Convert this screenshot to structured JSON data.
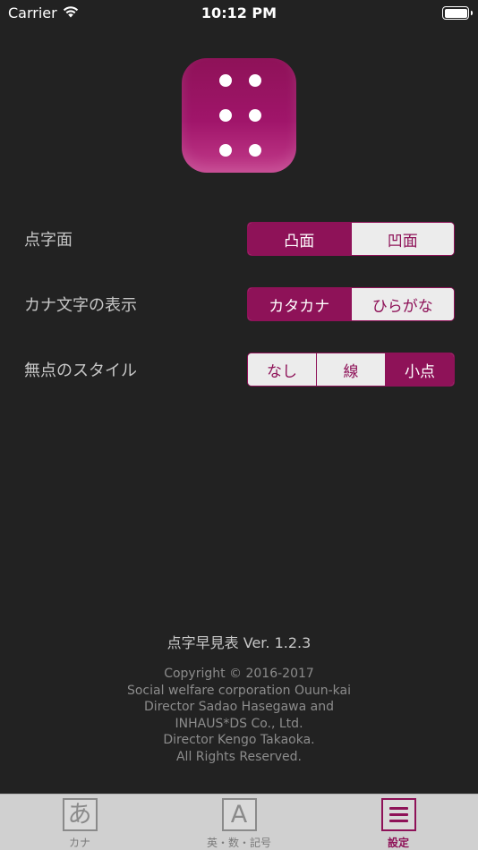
{
  "status_bar": {
    "carrier": "Carrier",
    "time": "10:12 PM",
    "wifi_icon": "wifi-icon",
    "battery_icon": "battery-icon"
  },
  "app_icon": {
    "name": "braille-six-dots-icon",
    "color": "#8e1258"
  },
  "settings": [
    {
      "label": "点字面",
      "options": [
        "凸面",
        "凹面"
      ],
      "selected": 0
    },
    {
      "label": "カナ文字の表示",
      "options": [
        "カタカナ",
        "ひらがな"
      ],
      "selected": 0
    },
    {
      "label": "無点のスタイル",
      "options": [
        "なし",
        "線",
        "小点"
      ],
      "selected": 2
    }
  ],
  "footer": {
    "version": "点字早見表 Ver. 1.2.3",
    "copyright_lines": [
      "Copyright © 2016-2017",
      "Social welfare corporation Ouun-kai",
      "Director Sadao Hasegawa and",
      "INHAUS*DS Co., Ltd.",
      "Director Kengo Takaoka.",
      "All Rights Reserved."
    ]
  },
  "tab_bar": {
    "tabs": [
      {
        "icon_glyph": "あ",
        "icon": "hiragana-a-icon",
        "label": "カナ",
        "active": false
      },
      {
        "icon_glyph": "A",
        "icon": "letter-a-icon",
        "label": "英・数・記号",
        "active": false
      },
      {
        "icon_glyph": "",
        "icon": "menu-icon",
        "label": "設定",
        "active": true
      }
    ]
  },
  "colors": {
    "accent": "#8e1258",
    "background": "#222222",
    "tab_bar": "#d0d0d0"
  }
}
